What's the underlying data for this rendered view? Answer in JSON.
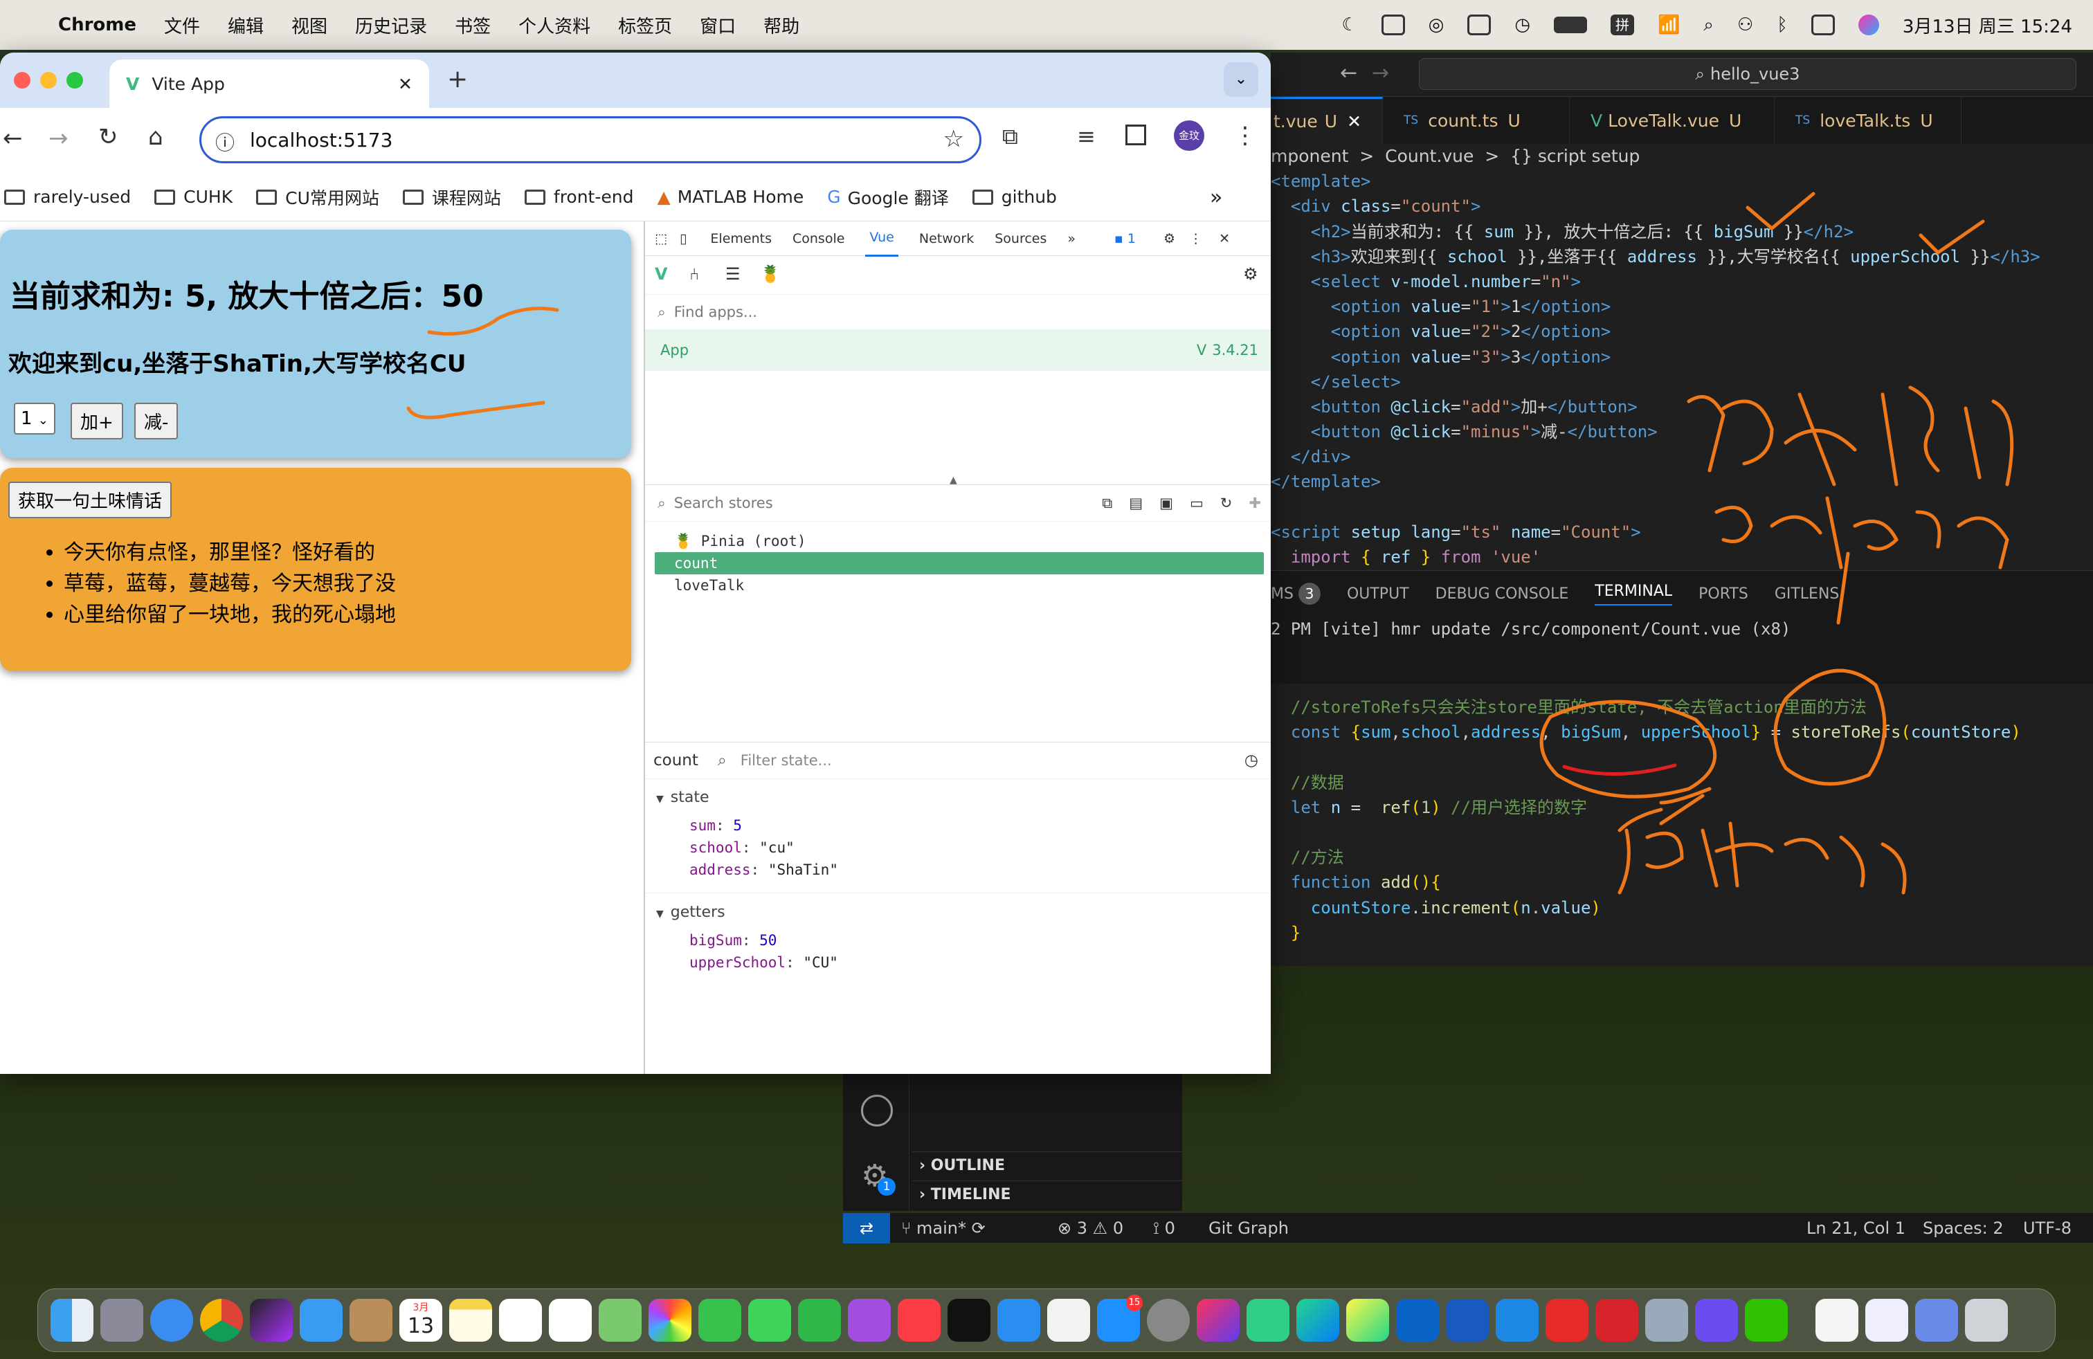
{
  "menubar": {
    "app": "Chrome",
    "items": [
      "文件",
      "编辑",
      "视图",
      "历史记录",
      "书签",
      "个人资料",
      "标签页",
      "窗口",
      "帮助"
    ],
    "datetime": "3月13日 周三  15:24"
  },
  "browser": {
    "tab_title": "Vite App",
    "url": "localhost:5173",
    "profile_label": "金玟",
    "bookmarks": [
      "rarely-used",
      "CUHK",
      "CU常用网站",
      "课程网站",
      "front-end",
      "MATLAB Home",
      "Google 翻译",
      "github"
    ]
  },
  "app": {
    "sum_heading": "当前求和为: 5, 放大十倍之后：50",
    "school_heading": "欢迎来到cu,坐落于ShaTin,大写学校名CU",
    "select_value": "1",
    "add_button": "加+",
    "minus_button": "减-",
    "fetch_button": "获取一句土味情话",
    "talks": [
      "今天你有点怪，那里怪？怪好看的",
      "草莓，蓝莓，蔓越莓，今天想我了没",
      "心里给你留了一块地，我的死心塌地"
    ]
  },
  "devtools": {
    "tabs": [
      "Elements",
      "Console",
      "Vue",
      "Network",
      "Sources"
    ],
    "issues_count": "1",
    "find_apps_placeholder": "Find apps...",
    "app_name": "App",
    "vue_version": "3.4.21",
    "search_stores_placeholder": "Search stores",
    "stores": [
      "🍍 Pinia (root)",
      "count",
      "loveTalk"
    ],
    "selected_store": "count",
    "filter_placeholder": "Filter state...",
    "state_label": "state",
    "state": [
      {
        "key": "sum",
        "value": "5"
      },
      {
        "key": "school",
        "value": "\"cu\""
      },
      {
        "key": "address",
        "value": "\"ShaTin\""
      }
    ],
    "getters_label": "getters",
    "getters": [
      {
        "key": "bigSum",
        "value": "50"
      },
      {
        "key": "upperSchool",
        "value": "\"CU\""
      }
    ]
  },
  "vscode": {
    "search": "hello_vue3",
    "tabs": [
      {
        "label": "t.vue",
        "badge": "U"
      },
      {
        "label": "count.ts",
        "badge": "U",
        "prefix": "TS"
      },
      {
        "label": "LoveTalk.vue",
        "badge": "U"
      },
      {
        "label": "loveTalk.ts",
        "badge": "U",
        "prefix": "TS"
      }
    ],
    "breadcrumb": "mponent  >  Count.vue  >  {} script setup",
    "panel_tabs": [
      "MS",
      "OUTPUT",
      "DEBUG CONSOLE",
      "TERMINAL",
      "PORTS",
      "GITLENS"
    ],
    "problems_count": "3",
    "terminal_line": "2 PM [vite] hmr update /src/component/Count.vue (x8)",
    "outline": "OUTLINE",
    "timeline": "TIMELINE",
    "settings_badge": "1",
    "status": {
      "branch": "main*",
      "errors": "3",
      "warnings": "0",
      "ports": "0",
      "git_graph": "Git Graph",
      "position": "Ln 21, Col 1",
      "spaces": "Spaces: 2",
      "encoding": "UTF-8"
    }
  },
  "dock": {
    "calendar_month": "3月",
    "calendar_day": "13",
    "appstore_badge": "15"
  }
}
